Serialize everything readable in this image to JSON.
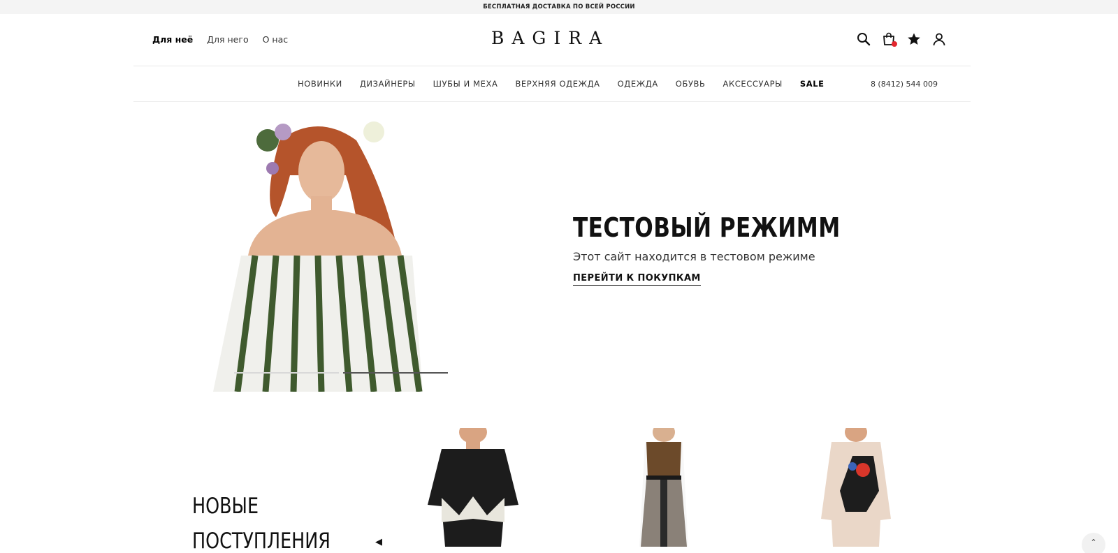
{
  "topbar": {
    "text": "БЕСПЛАТНАЯ ДОСТАВКА ПО ВСЕЙ РОССИИ"
  },
  "gender_nav": [
    {
      "label": "Для неё"
    },
    {
      "label": "Для него"
    },
    {
      "label": "О нас"
    }
  ],
  "logo": {
    "text": "BAGIRA"
  },
  "header_icons": [
    "search-icon",
    "cart-icon",
    "star-icon",
    "user-icon"
  ],
  "cart": {
    "indicator_color": "#e3262e"
  },
  "categories": [
    {
      "label": "НОВИНКИ"
    },
    {
      "label": "ДИЗАЙНЕРЫ"
    },
    {
      "label": "ШУБЫ И МЕХА"
    },
    {
      "label": "ВЕРХНЯЯ ОДЕЖДА"
    },
    {
      "label": "ОДЕЖДА"
    },
    {
      "label": "ОБУВЬ"
    },
    {
      "label": "АКСЕССУАРЫ"
    },
    {
      "label": "SALE"
    }
  ],
  "phone": "8 (8412) 544 009",
  "hero": {
    "title": "ТЕСТОВЫЙ РЕЖИММ",
    "subtitle": "Этот сайт находится в тестовом режиме",
    "link": "ПЕРЕЙТИ К ПОКУПКАМ",
    "slides_total": 2,
    "active_slide": 1
  },
  "new_arrivals": {
    "title_line1": "НОВЫЕ",
    "title_line2": "ПОСТУПЛЕНИЯ",
    "prev_arrow": "◀"
  },
  "scroll_top": {
    "glyph": "⌃"
  }
}
